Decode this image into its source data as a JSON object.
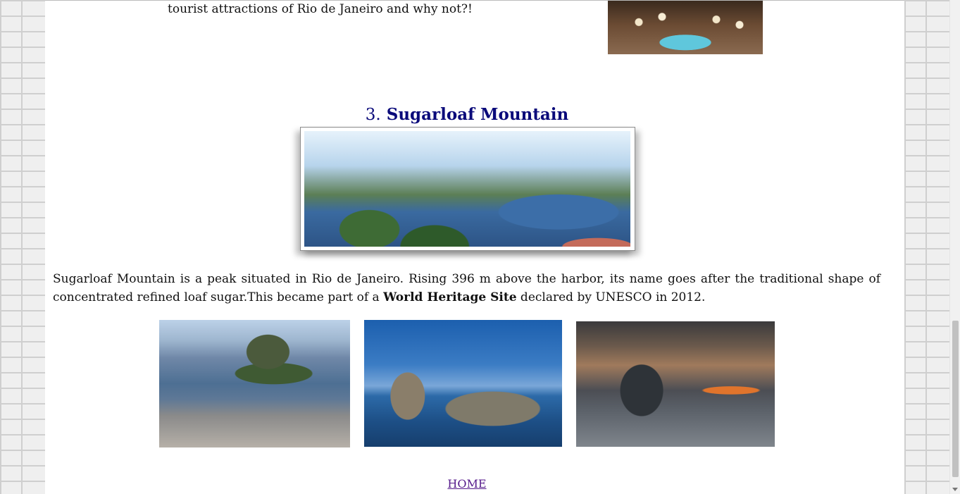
{
  "top": {
    "text": "tourist attractions of Rio de Janeiro and why not?!"
  },
  "section": {
    "number": "3.",
    "title": "Sugarloaf Mountain"
  },
  "description": {
    "part1": "Sugarloaf Mountain is a peak situated in Rio de Janeiro. Rising 396 m above the harbor, its name goes after the traditional shape of concentrated refined loaf sugar.This became part of a ",
    "bold": "World Heritage Site",
    "part2": " declared by UNESCO in 2012."
  },
  "footer": {
    "home_label": "HOME"
  },
  "colors": {
    "title": "#0a0a7a",
    "link_visited": "#551a8b"
  }
}
